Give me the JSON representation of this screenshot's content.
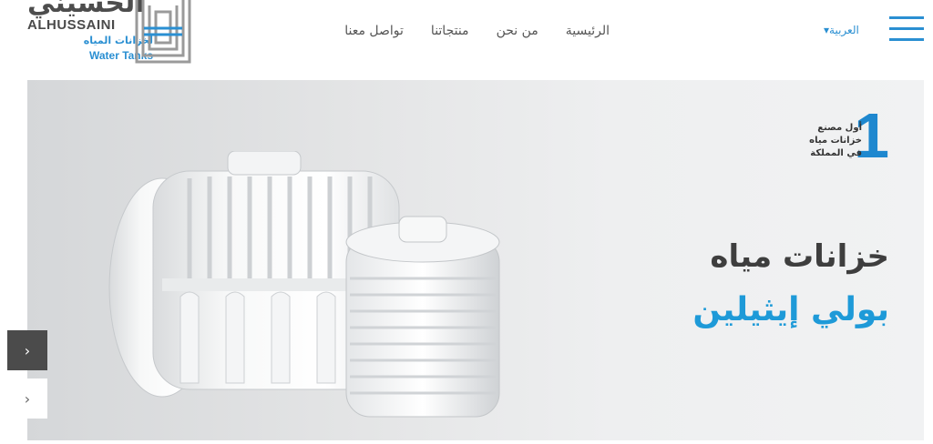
{
  "logo": {
    "name_ar": "الحسيني",
    "name_en": "ALHUSSAINI",
    "tagline_ar": "لخزانات المياه",
    "tagline_en": "Water Tanks",
    "brand_blue": "#2a8fd2",
    "brand_gray": "#4d4d4d"
  },
  "nav": {
    "items": [
      {
        "label": "الرئيسية"
      },
      {
        "label": "من نحن"
      },
      {
        "label": "منتجاتنا"
      },
      {
        "label": "تواصل معنا"
      }
    ]
  },
  "language": {
    "selected": "العربية",
    "icon": "caret-down-icon"
  },
  "menu": {
    "icon": "hamburger-icon"
  },
  "hero": {
    "badge_number": "1",
    "badge_lines": [
      "أول مصنع",
      "خزانات مياه",
      "في المملكة"
    ],
    "title_line1": "خزانات مياه",
    "title_line2": "بولي إيثيلين",
    "accent": "#1e9ad8"
  },
  "slider": {
    "prev_icon": "chevron-right-icon",
    "next_icon": "chevron-right-icon",
    "prev_glyph": "›",
    "next_glyph": "›"
  }
}
